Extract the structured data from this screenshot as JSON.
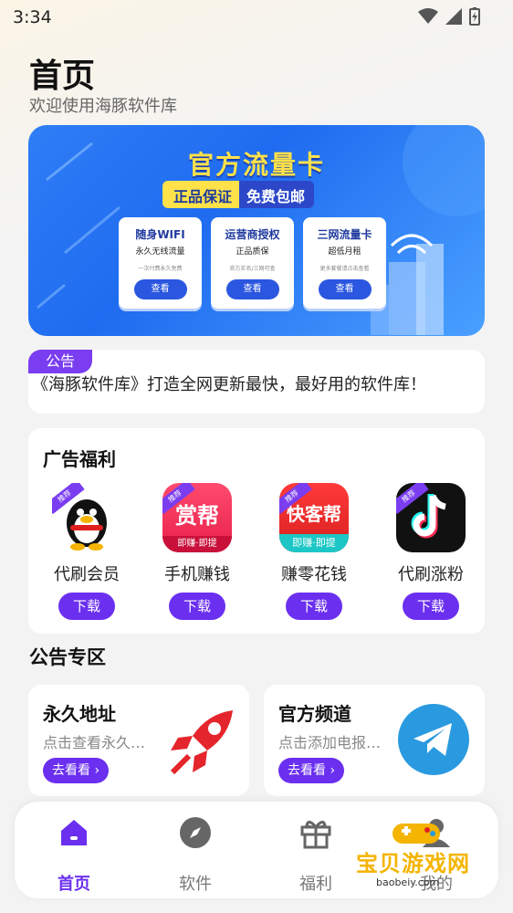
{
  "status": {
    "time": "3:34"
  },
  "header": {
    "title": "首页",
    "subtitle": "欢迎使用海豚软件库"
  },
  "banner": {
    "title": "官方流量卡",
    "badge_left": "正品保证",
    "badge_right": "免费包邮",
    "cards": [
      {
        "name": "随身WIFI",
        "sub": "永久无线流量",
        "note": "一次付费永久免费",
        "button": "查看"
      },
      {
        "name": "运营商授权",
        "sub": "正品质保",
        "note": "官方实名/三网可查",
        "button": "查看"
      },
      {
        "name": "三网流量卡",
        "sub": "超低月租",
        "note": "更多套餐请点击查看",
        "button": "查看"
      }
    ]
  },
  "notice": {
    "tag": "公告",
    "text": "《海豚软件库》打造全网更新最快，最好用的软件库！"
  },
  "ads": {
    "title": "广告福利",
    "items": [
      {
        "name": "代刷会员",
        "button": "下载",
        "tag": "推荐",
        "icon": "qq-penguin-icon",
        "icon_text": ""
      },
      {
        "name": "手机赚钱",
        "button": "下载",
        "tag": "推荐",
        "icon": "zhuanbang-icon",
        "icon_text": "赏帮",
        "icon_sub": "即赚·即提"
      },
      {
        "name": "赚零花钱",
        "button": "下载",
        "tag": "推荐",
        "icon": "kuaikebang-icon",
        "icon_text": "快客帮",
        "icon_sub": "即赚·即提"
      },
      {
        "name": "代刷涨粉",
        "button": "下载",
        "tag": "推荐",
        "icon": "tiktok-icon",
        "icon_text": ""
      }
    ]
  },
  "section": {
    "title": "公告专区"
  },
  "promos": [
    {
      "title": "永久地址",
      "desc": "点击查看永久地址",
      "button": "去看看"
    },
    {
      "title": "官方频道",
      "desc": "点击添加电报频道",
      "button": "去看看"
    }
  ],
  "tabs": [
    {
      "label": "首页",
      "icon": "home-icon",
      "active": true
    },
    {
      "label": "软件",
      "icon": "compass-icon",
      "active": false
    },
    {
      "label": "福利",
      "icon": "gift-icon",
      "active": false
    },
    {
      "label": "我的",
      "icon": "profile-icon",
      "active": false
    }
  ],
  "watermark": {
    "text": "宝贝游戏网",
    "url": "baobeiy.com"
  },
  "colors": {
    "accent": "#6b2ff0",
    "banner": "#1f6cf0",
    "notice_tag": "#7a3df0"
  }
}
